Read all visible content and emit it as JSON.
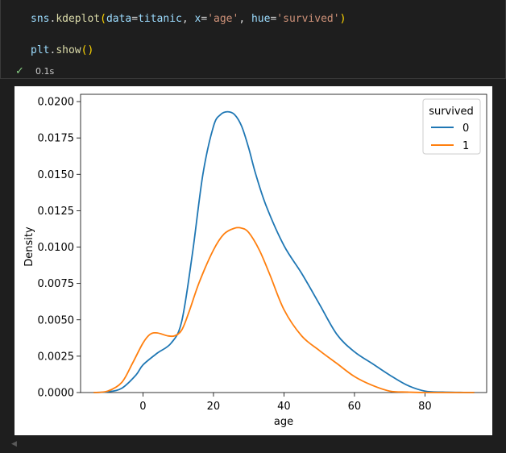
{
  "code": {
    "line1": {
      "obj": "sns",
      "dot": ".",
      "fn": "kdeplot",
      "open": "(",
      "arg1": "data",
      "eq1": "=",
      "val1": "titanic",
      "comma1": ", ",
      "arg2": "x",
      "eq2": "=",
      "val2": "'age'",
      "comma2": ", ",
      "arg3": "hue",
      "eq3": "=",
      "val3": "'survived'",
      "close": ")"
    },
    "line2": {
      "obj": "plt",
      "dot": ".",
      "fn": "show",
      "parens": "()"
    }
  },
  "status": {
    "check_icon": "check-icon",
    "time": "0.1s"
  },
  "colors": {
    "series_0": "#1f77b4",
    "series_1": "#ff7f0e",
    "editor_bg": "#1e1e1e",
    "success": "#89d185"
  },
  "chart_data": {
    "type": "line",
    "xlabel": "age",
    "ylabel": "Density",
    "xlim": [
      -17.7,
      97.5
    ],
    "ylim": [
      0,
      0.0205
    ],
    "xticks": [
      0,
      20,
      40,
      60,
      80
    ],
    "xtick_labels": [
      "0",
      "20",
      "40",
      "60",
      "80"
    ],
    "yticks": [
      0,
      0.0025,
      0.005,
      0.0075,
      0.01,
      0.0125,
      0.015,
      0.0175,
      0.02
    ],
    "ytick_labels": [
      "0.0000",
      "0.0025",
      "0.0050",
      "0.0075",
      "0.0100",
      "0.0125",
      "0.0150",
      "0.0175",
      "0.0200"
    ],
    "grid": false,
    "legend": {
      "title": "survived",
      "placement": "top-right",
      "entries": [
        "0",
        "1"
      ]
    },
    "series": [
      {
        "name": "0",
        "x": [
          -14,
          -10,
          -6,
          -2,
          0,
          4,
          8,
          11,
          14,
          17,
          20,
          22,
          24,
          26,
          28,
          30,
          32,
          35,
          40,
          45,
          50,
          55,
          60,
          65,
          70,
          75,
          80,
          85,
          90,
          94
        ],
        "y": [
          0.0,
          5e-05,
          0.0003,
          0.0012,
          0.0019,
          0.0027,
          0.0034,
          0.0049,
          0.0095,
          0.015,
          0.0183,
          0.0191,
          0.0193,
          0.0191,
          0.0183,
          0.0168,
          0.015,
          0.0128,
          0.0101,
          0.0082,
          0.0061,
          0.004,
          0.0028,
          0.002,
          0.0012,
          0.0005,
          0.0001,
          3e-05,
          1e-05,
          0.0
        ]
      },
      {
        "name": "1",
        "x": [
          -14,
          -10,
          -6,
          -3,
          0,
          2,
          4,
          7,
          9,
          11,
          13,
          16,
          20,
          23,
          26,
          28,
          30,
          33,
          36,
          40,
          45,
          50,
          55,
          60,
          65,
          70,
          75,
          80,
          85,
          90,
          94
        ],
        "y": [
          0.0,
          0.0001,
          0.0007,
          0.002,
          0.0034,
          0.004,
          0.0041,
          0.0039,
          0.0039,
          0.0043,
          0.0055,
          0.0076,
          0.0098,
          0.0109,
          0.0113,
          0.0113,
          0.011,
          0.0098,
          0.0081,
          0.0057,
          0.0039,
          0.0029,
          0.002,
          0.0011,
          0.0005,
          0.0001,
          3e-05,
          0.0,
          0.0,
          0.0,
          0.0
        ]
      }
    ]
  }
}
